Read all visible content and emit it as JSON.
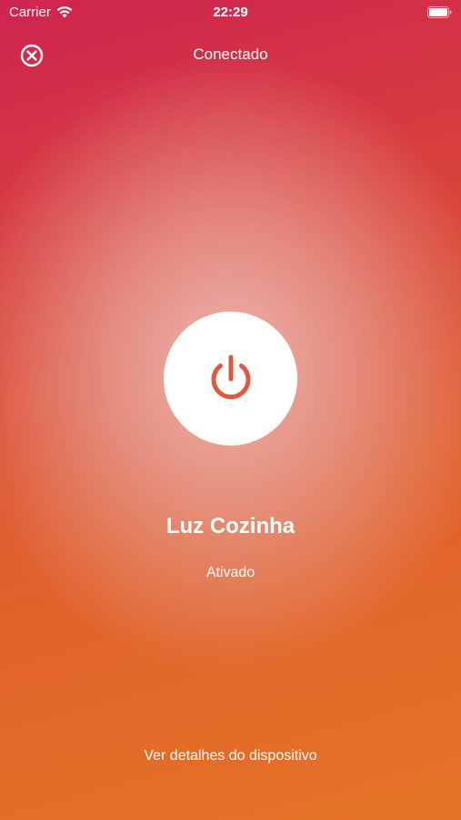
{
  "status_bar": {
    "carrier": "Carrier",
    "time": "22:29",
    "wifi_icon": "wifi-icon",
    "battery_icon": "battery-icon"
  },
  "nav": {
    "close_icon": "close-circle-icon",
    "title": "Conectado"
  },
  "device": {
    "power_icon": "power-icon",
    "name": "Luz Cozinha",
    "status": "Ativado"
  },
  "footer": {
    "details_link": "Ver detalhes do dispositivo"
  },
  "colors": {
    "accent": "#e2583f",
    "background_top": "#cf2450",
    "background_bottom": "#e57426"
  }
}
